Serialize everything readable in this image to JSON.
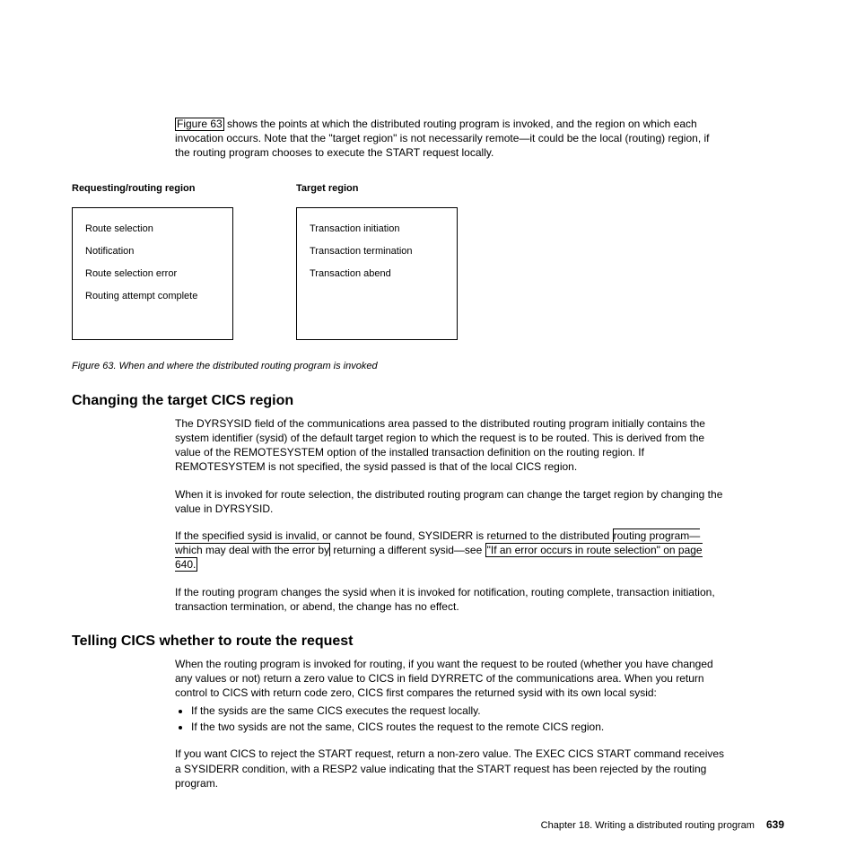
{
  "intro": {
    "link_label": "Figure 63",
    "rest": " shows the points at which the distributed routing program is invoked, and the region on which each invocation occurs. Note that the \"target region\" is not necessarily remote—it could be the local (routing) region, if the routing program chooses to execute the START request locally."
  },
  "diagram": {
    "left_header": "Requesting/routing region",
    "right_header": "Target region",
    "left_items": [
      "Route selection",
      "Notification",
      "Route selection error",
      "Routing attempt complete"
    ],
    "right_items": [
      "Transaction initiation",
      "Transaction termination",
      "Transaction abend"
    ]
  },
  "figure_caption": "Figure 63. When and where the distributed routing program is invoked",
  "section1": {
    "heading": "Changing the target CICS region",
    "p1": "The DYRSYSID field of the communications area passed to the distributed routing program initially contains the system identifier (sysid) of the default target region to which the request is to be routed. This is derived from the value of the REMOTESYSTEM option of the installed transaction definition on the routing region. If REMOTESYSTEM is not specified, the sysid passed is that of the local CICS region.",
    "p2": "When it is invoked for route selection, the distributed routing program can change the target region by changing the value in DYRSYSID.",
    "p3a": "If the specified sysid is invalid, or cannot be found, SYSIDERR is returned to the distributed ",
    "p3b": "routing program—which may deal with the error by",
    "p3c": " returning a different sysid—see ",
    "p3_link": "\"If an error occurs in route selection\" on page 640.",
    "p4": "If the routing program changes the sysid when it is invoked for notification, routing complete, transaction initiation, transaction termination, or abend, the change has no effect."
  },
  "section2": {
    "heading": "Telling CICS whether to route the request",
    "p1": "When the routing program is invoked for routing, if you want the request to be routed (whether you have changed any values or not) return a zero value to CICS in field DYRRETC of the communications area. When you return control to CICS with return code zero, CICS first compares the returned sysid with its own local sysid:",
    "b1": "If the sysids are the same CICS executes the request locally.",
    "b2": "If the two sysids are not the same, CICS routes the request to the remote CICS region.",
    "p2": "If you want CICS to reject the START request, return a non-zero value. The EXEC CICS START command receives a SYSIDERR condition, with a RESP2 value indicating that the START request has been rejected by the routing program."
  },
  "footer": {
    "chapter": "Chapter 18. Writing a distributed routing program",
    "page": "639"
  }
}
